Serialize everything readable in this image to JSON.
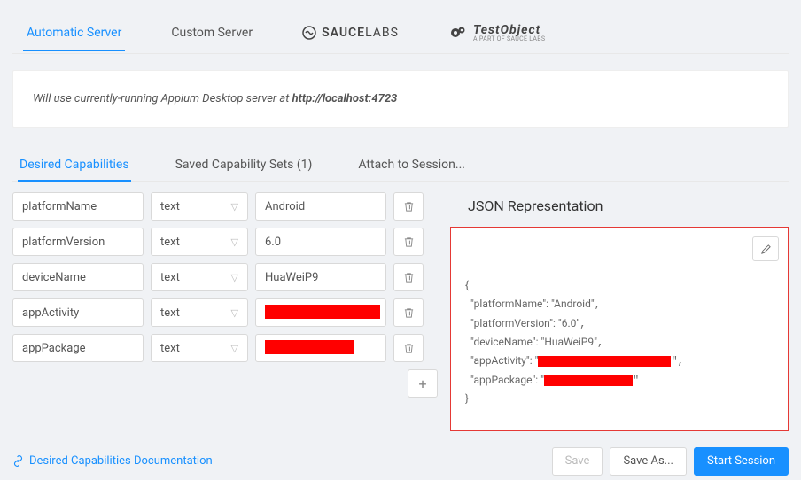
{
  "top_tabs": {
    "automatic": "Automatic Server",
    "custom": "Custom Server",
    "sauce_brand_left": "SAUCE",
    "sauce_brand_right": "LABS",
    "testobject_brand": "TestObject",
    "testobject_sub": "A PART OF SAUCE LABS"
  },
  "banner": {
    "prefix": "Will use currently-running Appium Desktop server at ",
    "url": "http://localhost:4723"
  },
  "sub_tabs": {
    "desired": "Desired Capabilities",
    "saved": "Saved Capability Sets (1)",
    "attach": "Attach to Session..."
  },
  "caps": [
    {
      "name": "platformName",
      "type": "text",
      "value": "Android",
      "redacted": false
    },
    {
      "name": "platformVersion",
      "type": "text",
      "value": "6.0",
      "redacted": false
    },
    {
      "name": "deviceName",
      "type": "text",
      "value": "HuaWeiP9",
      "redacted": false
    },
    {
      "name": "appActivity",
      "type": "text",
      "value": "",
      "redacted": true,
      "redact_w": 130
    },
    {
      "name": "appPackage",
      "type": "text",
      "value": "",
      "redacted": true,
      "redact_w": 100
    }
  ],
  "json": {
    "title": "JSON Representation",
    "lines": {
      "l0": "{",
      "l1_k": "  \"platformName\": ",
      "l1_v": "\"Android\"",
      "l2_k": "  \"platformVersion\": ",
      "l2_v": "\"6.0\"",
      "l3_k": "  \"deviceName\": ",
      "l3_v": "\"HuaWeiP9\"",
      "l4_k": "  \"appActivity\": \"",
      "l5_k": "  \"appPackage\": \"",
      "l6": "}"
    }
  },
  "footer": {
    "doc_link": "Desired Capabilities Documentation",
    "save": "Save",
    "save_as": "Save As...",
    "start": "Start Session"
  }
}
